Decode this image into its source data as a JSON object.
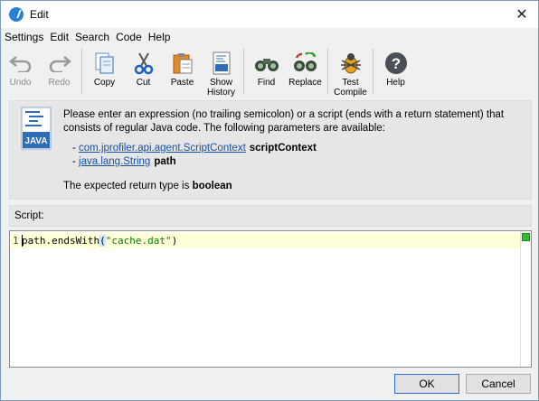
{
  "window": {
    "title": "Edit"
  },
  "menu": [
    "Settings",
    "Edit",
    "Search",
    "Code",
    "Help"
  ],
  "toolbar": {
    "undo": "Undo",
    "redo": "Redo",
    "copy": "Copy",
    "cut": "Cut",
    "paste": "Paste",
    "show_history": "Show History",
    "find": "Find",
    "replace": "Replace",
    "test_compile": "Test Compile",
    "help": "Help"
  },
  "info": {
    "description": "Please enter an expression (no trailing semicolon) or a script (ends with a return statement) that consists of regular Java code. The following parameters are available:",
    "params": [
      {
        "prefix": "- ",
        "type": "com.jprofiler.api.agent.ScriptContext",
        "name": "scriptContext"
      },
      {
        "prefix": "- ",
        "type": "java.lang.String",
        "name": "path"
      }
    ],
    "return_prefix": "The expected return type is ",
    "return_type": "boolean"
  },
  "script_label": "Script:",
  "editor": {
    "line_number": "1",
    "code_before": "path.endsWith",
    "open_paren": "(",
    "string_literal": "\"cache.dat\"",
    "close_paren": ")"
  },
  "buttons": {
    "ok": "OK",
    "cancel": "Cancel"
  },
  "colors": {
    "link": "#1a4fa0",
    "current_line": "#ffffd8",
    "status_ok": "#2fbe2f",
    "java_icon_blue": "#2f6eb5"
  }
}
